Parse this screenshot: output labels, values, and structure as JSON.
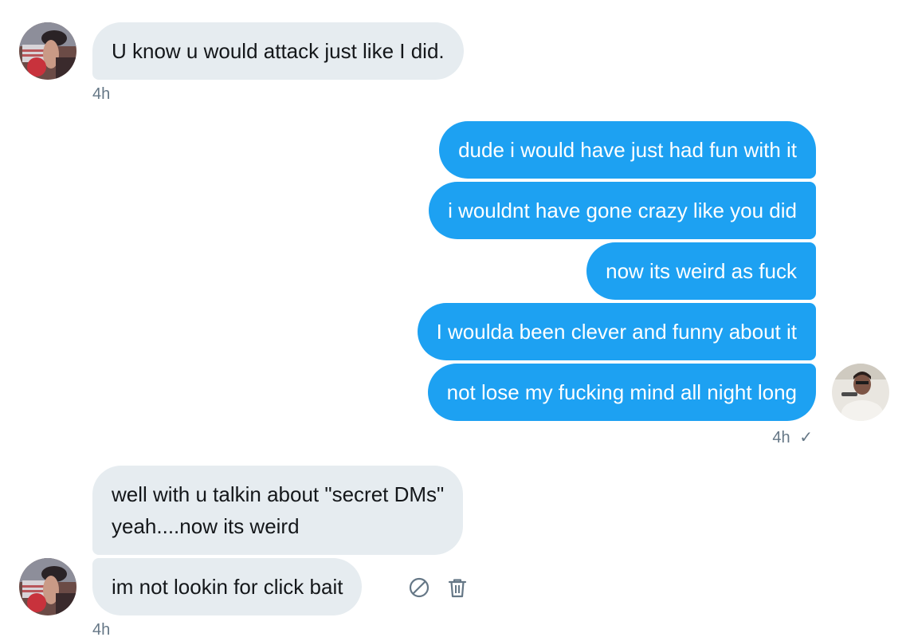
{
  "conversation": {
    "messages": [
      {
        "direction": "received",
        "text": "U know u would attack just like I did."
      },
      {
        "direction": "sent",
        "text": "dude i would have just had fun with it"
      },
      {
        "direction": "sent",
        "text": "i wouldnt have gone crazy like you did"
      },
      {
        "direction": "sent",
        "text": "now its weird as fuck"
      },
      {
        "direction": "sent",
        "text": "I woulda been clever and funny about it"
      },
      {
        "direction": "sent",
        "text": "not lose my fucking mind all night long"
      },
      {
        "direction": "received",
        "text_line1": "well with u talkin about \"secret DMs\"",
        "text_line2": "yeah....now its weird"
      },
      {
        "direction": "received",
        "text": "im not lookin for click bait"
      }
    ],
    "timestamps": {
      "first_received": "4h",
      "sent_group": "4h",
      "sent_status": "✓",
      "last_received": "4h"
    },
    "icons": {
      "other_avatar": "profile-avatar",
      "own_avatar": "profile-avatar",
      "report": "block-icon",
      "delete": "trash-icon"
    },
    "colors": {
      "sent_bubble": "#1da1f2",
      "received_bubble": "#e6ecf0",
      "meta_text": "#657786"
    }
  }
}
